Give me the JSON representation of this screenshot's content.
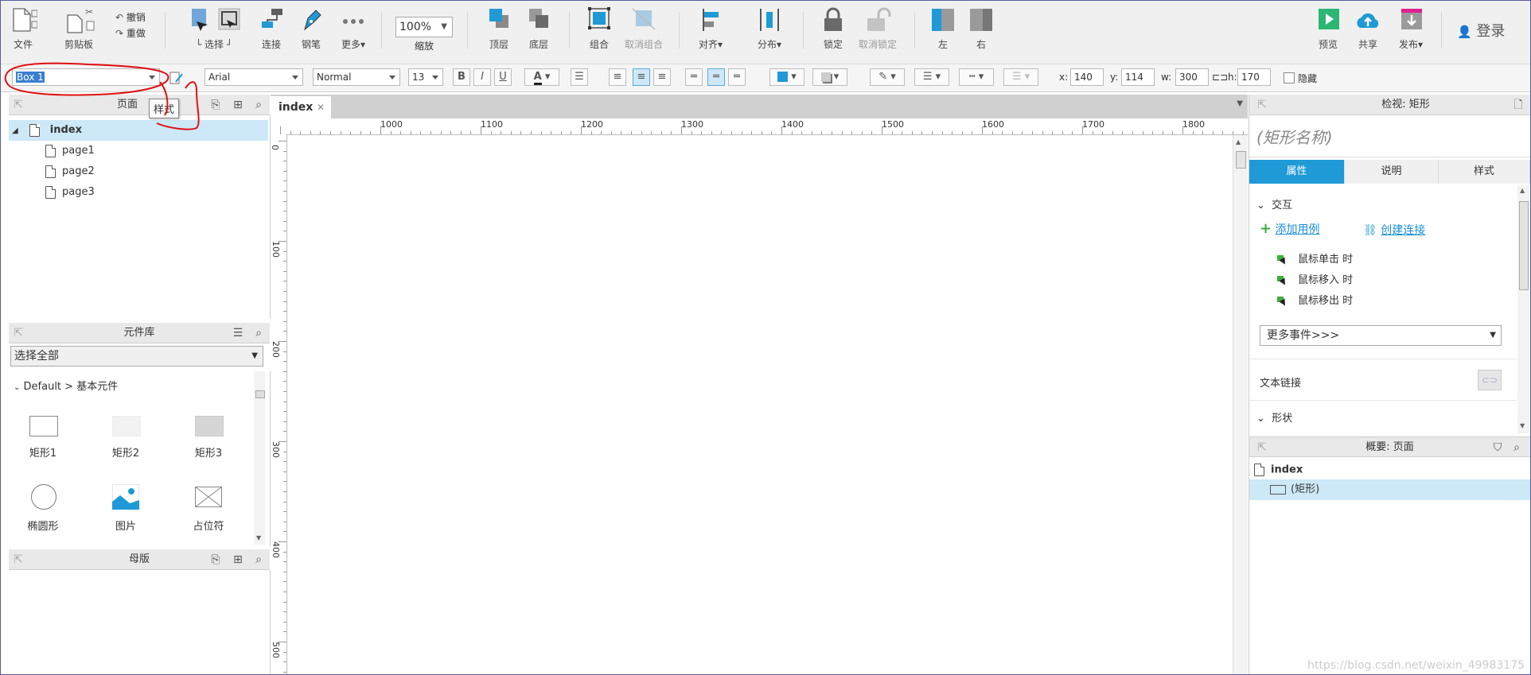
{
  "toolbar": {
    "file": "文件",
    "clipboard": "剪贴板",
    "undo": "撤销",
    "redo": "重做",
    "select": "选择",
    "connect": "连接",
    "pen": "钢笔",
    "more": "更多",
    "zoom_value": "100%",
    "zoom": "缩放",
    "top_layer": "顶层",
    "bottom_layer": "底层",
    "group": "组合",
    "ungroup": "取消组合",
    "align": "对齐",
    "distribute": "分布",
    "lock": "锁定",
    "unlock": "取消锁定",
    "left": "左",
    "right": "右",
    "preview": "预览",
    "share": "共享",
    "publish": "发布",
    "login": "登录"
  },
  "format": {
    "widget_name": "Box 1",
    "font_family": "Arial",
    "font_style": "Normal",
    "font_size": "13",
    "bold": "B",
    "italic": "I",
    "underline": "U",
    "font_color_letter": "A",
    "x_label": "x:",
    "x": "140",
    "y_label": "y:",
    "y": "114",
    "w_label": "w:",
    "w": "300",
    "h_label": "h:",
    "h": "170",
    "hide": "隐藏",
    "tooltip": "样式"
  },
  "pages_panel": {
    "title": "页面",
    "root": "index",
    "children": [
      "page1",
      "page2",
      "page3"
    ]
  },
  "library_panel": {
    "title": "元件库",
    "filter": "选择全部",
    "group": "Default > 基本元件",
    "widgets": [
      "矩形1",
      "矩形2",
      "矩形3",
      "椭圆形",
      "图片",
      "占位符"
    ]
  },
  "masters_panel": {
    "title": "母版"
  },
  "canvas": {
    "tab": "index",
    "hruler": [
      "1000",
      "1100",
      "1200",
      "1300",
      "1400",
      "1500",
      "1600",
      "1700",
      "1800"
    ],
    "vruler": [
      "0",
      "100",
      "200",
      "300",
      "400",
      "500"
    ]
  },
  "inspector": {
    "title": "检视: 矩形",
    "name_placeholder": "(矩形名称)",
    "tabs": [
      "属性",
      "说明",
      "样式"
    ],
    "interaction": "交互",
    "add_case": "添加用例",
    "create_link": "创建连接",
    "events": [
      "鼠标单击 时",
      "鼠标移入 时",
      "鼠标移出 时"
    ],
    "more_events": "更多事件>>>",
    "text_link": "文本链接",
    "shape": "形状"
  },
  "outline": {
    "title": "概要: 页面",
    "root": "index",
    "item": "(矩形)"
  },
  "watermark": "https://blog.csdn.net/weixin_49983175",
  "colors": {
    "accent": "#1f9ad6",
    "selection": "#cde8f7",
    "annotation_red": "#e01010"
  }
}
